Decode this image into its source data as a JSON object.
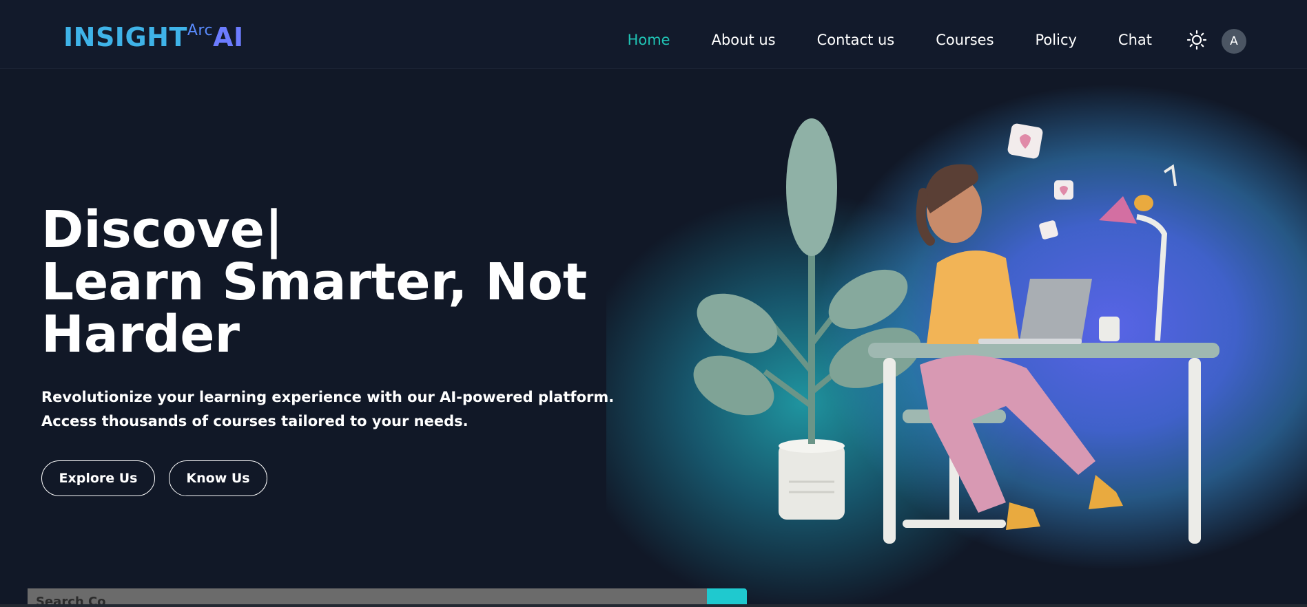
{
  "logo": {
    "part1": "INSIGHT",
    "part2": "Arc",
    "part3": "AI"
  },
  "nav": {
    "items": [
      {
        "label": "Home",
        "active": true
      },
      {
        "label": "About us",
        "active": false
      },
      {
        "label": "Contact us",
        "active": false
      },
      {
        "label": "Courses",
        "active": false
      },
      {
        "label": "Policy",
        "active": false
      },
      {
        "label": "Chat",
        "active": false
      }
    ],
    "theme_icon": "sun-icon",
    "avatar_initial": "A"
  },
  "hero": {
    "typed_text": "Discove|",
    "title_line2": "Learn Smarter, Not",
    "title_line3": "Harder",
    "description": "Revolutionize your learning experience with our AI-powered platform. Access thousands of courses tailored to your needs.",
    "explore_button": "Explore Us",
    "know_button": "Know Us"
  },
  "search": {
    "placeholder": "Search Co"
  },
  "colors": {
    "background": "#111827",
    "accent": "#20c4b5",
    "logo_blue": "#3fb3e8",
    "logo_violet": "#6c7cff"
  }
}
